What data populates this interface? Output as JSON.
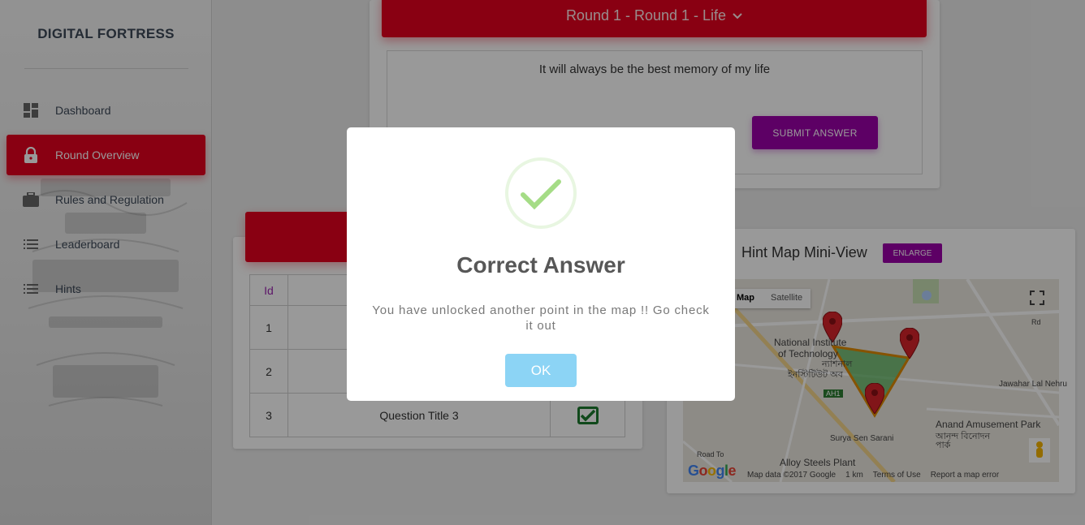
{
  "sidebar": {
    "brand": "DIGITAL FORTRESS",
    "items": [
      {
        "label": "Dashboard",
        "icon": "dashboard-icon"
      },
      {
        "label": "Round Overview",
        "icon": "lock-icon",
        "active": true
      },
      {
        "label": "Rules and Regulation",
        "icon": "briefcase-icon"
      },
      {
        "label": "Leaderboard",
        "icon": "list-icon"
      },
      {
        "label": "Hints",
        "icon": "list-icon"
      }
    ]
  },
  "round": {
    "selector_label": "Round 1 - Round 1 - Life",
    "question_text": "It will always be the best memory of my life",
    "submit_label": "SUBMIT ANSWER"
  },
  "questions": {
    "columns": [
      "Id",
      ""
    ],
    "rows": [
      {
        "id": "1",
        "title": ""
      },
      {
        "id": "2",
        "title": ""
      },
      {
        "id": "3",
        "title": "Question Title 3",
        "solved": true
      }
    ]
  },
  "hint_map": {
    "title": "Hint Map Mini-View",
    "enlarge_label": "ENLARGE",
    "map_type_options": [
      "Map",
      "Satellite"
    ],
    "selected_map_type": "Map",
    "labels": {
      "nit": "National Institute",
      "nit2": "of Technology",
      "bengali": "ন্যাশনাল",
      "bengali2": "ইনস্টিটিউট অব",
      "ah1": "AH1",
      "park": "Anand Amusement Park",
      "park_bn": "আনন্দ বিনোদন",
      "park_bn2": "পার্ক",
      "alloy": "Alloy Steels Plant",
      "surya": "Surya Sen Sarani",
      "jln": "Jawahar Lal Nehru",
      "road": "Road To",
      "rd": "Rd"
    },
    "footer": {
      "attribution": "Map data ©2017 Google",
      "scale": "1 km",
      "terms": "Terms of Use",
      "report": "Report a map error"
    },
    "google": "Google"
  },
  "modal": {
    "title": "Correct Answer",
    "text": "You have unlocked another point in the map !! Go check it out",
    "ok_label": "OK"
  },
  "colors": {
    "primary_red": "#e5001e",
    "purple": "#9c00a8",
    "success_green": "#a5dc86",
    "ok_blue": "#8cd4f5"
  }
}
